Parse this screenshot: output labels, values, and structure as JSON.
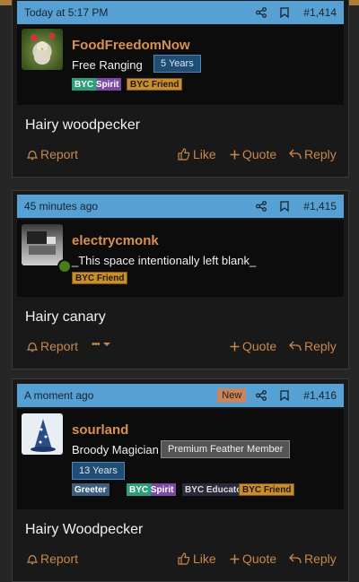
{
  "posts": [
    {
      "date": "Today at 5:17 PM",
      "number": "#1,414",
      "username": "FoodFreedomNow",
      "user_title": "Free Ranging",
      "years": "5 Years",
      "badges": [
        "BYC Spirit",
        "BYC Friend"
      ],
      "content": "Hairy woodpecker",
      "actions": {
        "report": "Report",
        "like": "Like",
        "quote": "Quote",
        "reply": "Reply"
      }
    },
    {
      "date": "45 minutes ago",
      "number": "#1,415",
      "username": "electrycmonk",
      "user_title": "_This space intentionally left blank_",
      "badges": [
        "BYC Friend"
      ],
      "content": "Hairy canary",
      "actions": {
        "report": "Report",
        "more": "•••",
        "quote": "Quote",
        "reply": "Reply"
      }
    },
    {
      "date": "A moment ago",
      "new_label": "New",
      "number": "#1,416",
      "username": "sourland",
      "user_title": "Broody Magician",
      "member_level": "Premium Feather Member",
      "years": "13 Years",
      "badges": [
        "Greeter",
        "BYC Spirit",
        "BYC Educator",
        "BYC Friend"
      ],
      "content": "Hairy Woodpecker",
      "actions": {
        "report": "Report",
        "like": "Like",
        "quote": "Quote",
        "reply": "Reply"
      }
    }
  ],
  "colors": {
    "header_bar": "#56a0d3",
    "username": "#d9914e",
    "action": "#c9874a",
    "background": "#262626"
  },
  "icons": [
    "share-icon",
    "bookmark-icon",
    "bell-icon",
    "thumbs-up-icon",
    "plus-icon",
    "reply-icon",
    "chevron-down-icon"
  ]
}
